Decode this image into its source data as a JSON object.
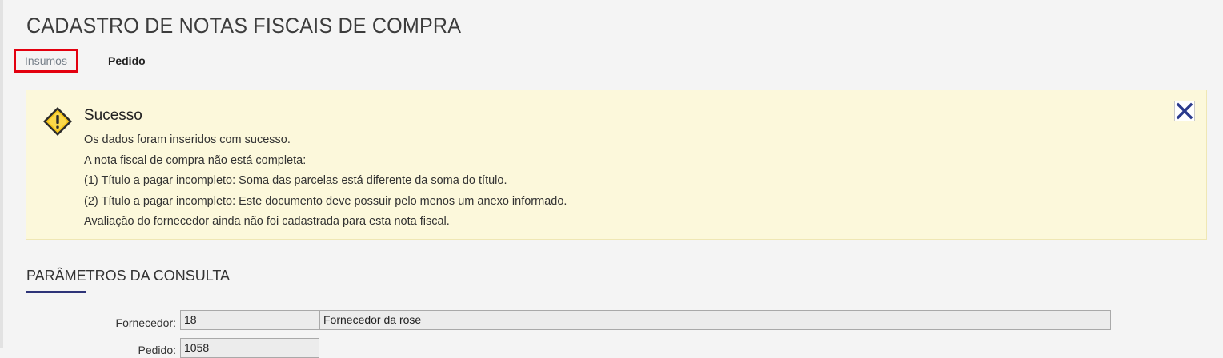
{
  "page": {
    "title": "CADASTRO DE NOTAS FISCAIS DE COMPRA"
  },
  "tabs": [
    {
      "label": "Insumos",
      "active": true
    },
    {
      "label": "Pedido",
      "active": false
    }
  ],
  "alert": {
    "icon": "warning-icon",
    "title": "Sucesso",
    "lines": [
      "Os dados foram inseridos com sucesso.",
      "A nota fiscal de compra não está completa:",
      "(1) Título a pagar incompleto: Soma das parcelas está diferente da soma do título.",
      "(2) Título a pagar incompleto: Este documento deve possuir pelo menos um anexo informado.",
      "Avaliação do fornecedor ainda não foi cadastrada para esta nota fiscal."
    ],
    "close_icon": "close-icon"
  },
  "section": {
    "title": "PARÂMETROS DA CONSULTA"
  },
  "form": {
    "fornecedor": {
      "label": "Fornecedor:",
      "code": "18",
      "name": "Fornecedor da rose"
    },
    "pedido": {
      "label": "Pedido:",
      "value": "1058"
    }
  },
  "colors": {
    "accent": "#2e3478",
    "highlight_border": "#e3000f",
    "alert_bg": "#fcf8db"
  }
}
